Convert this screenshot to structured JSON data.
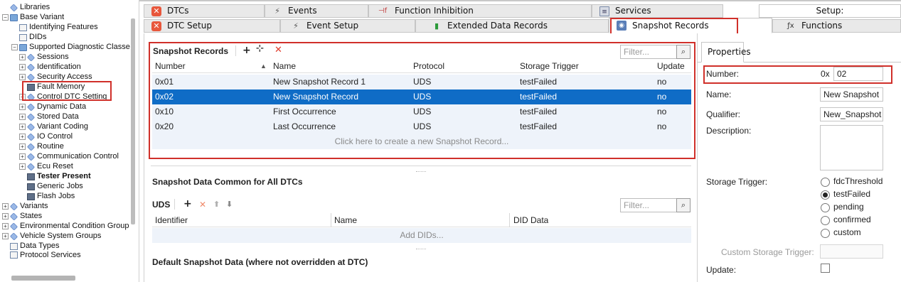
{
  "tree": [
    {
      "label": "Libraries"
    },
    {
      "label": "Base Variant"
    },
    {
      "label": "Identifying Features"
    },
    {
      "label": "DIDs"
    },
    {
      "label": "Supported Diagnostic Classe"
    },
    {
      "label": "Sessions"
    },
    {
      "label": "Identification"
    },
    {
      "label": "Security Access"
    },
    {
      "label": "Fault Memory"
    },
    {
      "label": "Control DTC Setting"
    },
    {
      "label": "Dynamic Data"
    },
    {
      "label": "Stored Data"
    },
    {
      "label": "Variant Coding"
    },
    {
      "label": "IO Control"
    },
    {
      "label": "Routine"
    },
    {
      "label": "Communication Control"
    },
    {
      "label": "Ecu Reset"
    },
    {
      "label": "Tester Present"
    },
    {
      "label": "Generic Jobs"
    },
    {
      "label": "Flash Jobs"
    },
    {
      "label": "Variants"
    },
    {
      "label": "States"
    },
    {
      "label": "Environmental Condition Group"
    },
    {
      "label": "Vehicle System Groups"
    },
    {
      "label": "Data Types"
    },
    {
      "label": "Protocol Services"
    }
  ],
  "tabs_row1": [
    {
      "label": "DTCs",
      "icon": "dtc-icon"
    },
    {
      "label": "Events",
      "icon": "lightning-icon"
    },
    {
      "label": "Function Inhibition",
      "icon": "function-inhibition-icon"
    },
    {
      "label": "Services",
      "icon": "services-icon"
    },
    {
      "label": "Setup:",
      "icon": ""
    }
  ],
  "tabs_row2": [
    {
      "label": "DTC Setup",
      "icon": "dtc-setup-icon"
    },
    {
      "label": "Event Setup",
      "icon": "event-setup-icon"
    },
    {
      "label": "Extended Data Records",
      "icon": "bar-chart-icon"
    },
    {
      "label": "Snapshot Records",
      "icon": "camera-icon"
    },
    {
      "label": "Functions",
      "icon": "function-icon"
    }
  ],
  "snapshot": {
    "title": "Snapshot Records",
    "add": "+",
    "delete": "✕",
    "filter_placeholder": "Filter...",
    "columns": [
      "Number",
      "Name",
      "Protocol",
      "Storage Trigger",
      "Update"
    ],
    "rows": [
      {
        "number": "0x01",
        "name": "New Snapshot Record 1",
        "protocol": "UDS",
        "trigger": "testFailed",
        "update": "no"
      },
      {
        "number": "0x02",
        "name": "New Snapshot Record",
        "protocol": "UDS",
        "trigger": "testFailed",
        "update": "no"
      },
      {
        "number": "0x10",
        "name": "First Occurrence",
        "protocol": "UDS",
        "trigger": "testFailed",
        "update": "no"
      },
      {
        "number": "0x20",
        "name": "Last Occurrence",
        "protocol": "UDS",
        "trigger": "testFailed",
        "update": "no"
      }
    ],
    "create_hint": "Click here to create a new Snapshot Record..."
  },
  "common": {
    "title": "Snapshot Data Common for All DTCs",
    "protocol": "UDS",
    "add": "+",
    "delete": "✕",
    "up": "⬆",
    "down": "⬇",
    "filter_placeholder": "Filter...",
    "columns": [
      "Identifier",
      "Name",
      "DID Data"
    ],
    "add_hint": "Add DIDs..."
  },
  "default_title": "Default Snapshot Data (where not overridden at DTC)",
  "properties": {
    "tab": "Properties",
    "number_label": "Number:",
    "number_prefix": "0x",
    "number_value": "02",
    "name_label": "Name:",
    "name_value": "New Snapshot",
    "qualifier_label": "Qualifier:",
    "qualifier_value": "New_Snapshot",
    "description_label": "Description:",
    "storage_trigger_label": "Storage Trigger:",
    "trigger_options": [
      "fdcThreshold",
      "testFailed",
      "pending",
      "confirmed",
      "custom"
    ],
    "trigger_selected": "testFailed",
    "custom_trigger_label": "Custom Storage Trigger:",
    "update_label": "Update:"
  },
  "colors": {
    "selection": "#0f6cc6",
    "highlight_box": "#d0302a"
  }
}
